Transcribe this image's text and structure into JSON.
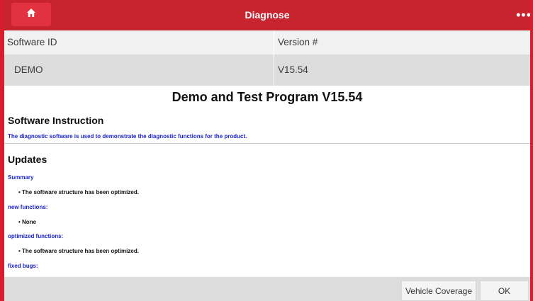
{
  "header": {
    "title": "Diagnose",
    "home_icon": "home-icon",
    "more_icon": "more-icon",
    "more_glyph": "•••",
    "accent": "#c8242f"
  },
  "software_table": {
    "columns": [
      "Software ID",
      "Version #"
    ],
    "row": [
      "DEMO",
      "V15.54"
    ]
  },
  "content": {
    "program_title": "Demo and Test Program V15.54",
    "instruction_heading": "Software Instruction",
    "instruction_text": "The diagnostic software is used to demonstrate the diagnostic functions for the product.",
    "updates_heading": "Updates",
    "summary_label": "Summary",
    "summary_item": "• The software structure has been optimized.",
    "new_functions_label": "new functions:",
    "new_functions_item": "• None",
    "optimized_functions_label": "optimized functions:",
    "optimized_functions_item": "• The software structure has been optimized.",
    "fixed_bugs_label": "fixed bugs:",
    "link_color": "#1a22cc"
  },
  "footer": {
    "vehicle_coverage_label": "Vehicle Coverage",
    "ok_label": "OK"
  }
}
